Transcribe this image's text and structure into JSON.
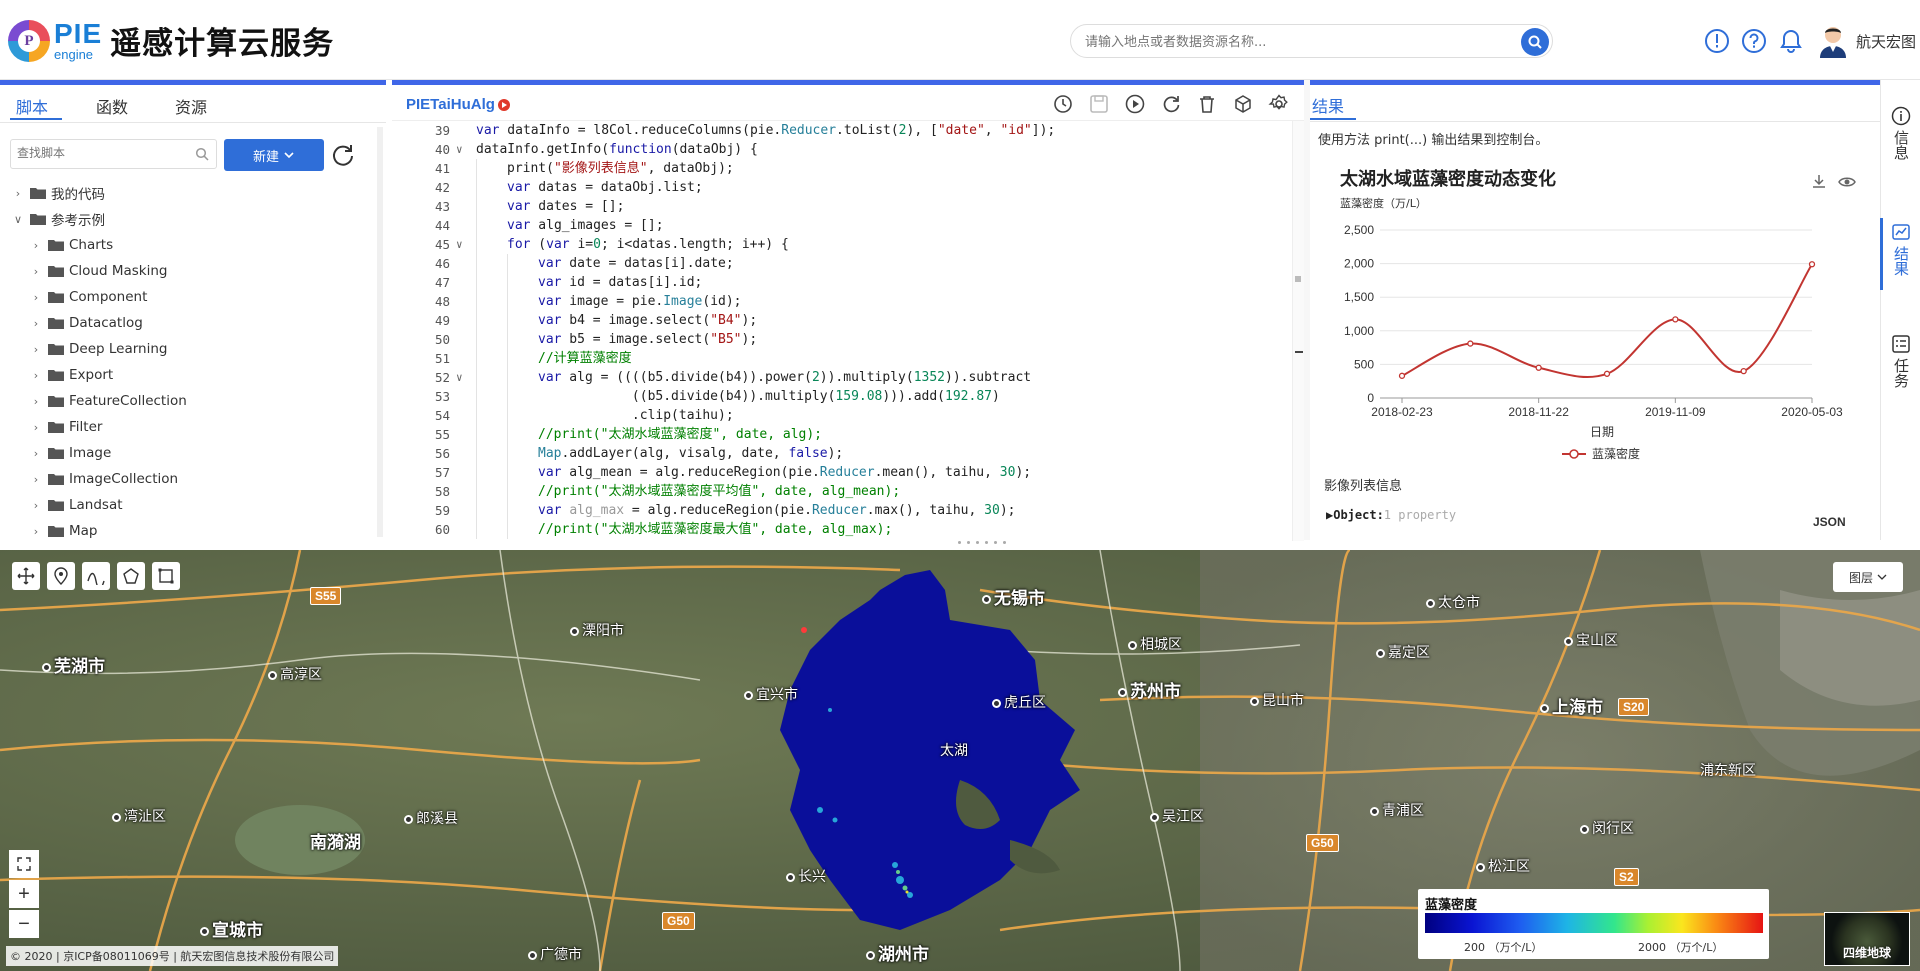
{
  "header": {
    "logo_text": "PIE",
    "logo_sub": "engine",
    "logo_p": "P",
    "title": "遥感计算云服务",
    "search_placeholder": "请输入地点或者数据资源名称...",
    "user_name": "航天宏图"
  },
  "left": {
    "tabs": [
      "脚本",
      "函数",
      "资源"
    ],
    "search_placeholder": "查找脚本",
    "new_button": "新建",
    "tree": [
      {
        "label": "我的代码",
        "level": 0,
        "open": false
      },
      {
        "label": "参考示例",
        "level": 0,
        "open": true
      },
      {
        "label": "Charts",
        "level": 1,
        "open": false
      },
      {
        "label": "Cloud Masking",
        "level": 1,
        "open": false
      },
      {
        "label": "Component",
        "level": 1,
        "open": false
      },
      {
        "label": "Datacatlog",
        "level": 1,
        "open": false
      },
      {
        "label": "Deep Learning",
        "level": 1,
        "open": false
      },
      {
        "label": "Export",
        "level": 1,
        "open": false
      },
      {
        "label": "FeatureCollection",
        "level": 1,
        "open": false
      },
      {
        "label": "Filter",
        "level": 1,
        "open": false
      },
      {
        "label": "Image",
        "level": 1,
        "open": false
      },
      {
        "label": "ImageCollection",
        "level": 1,
        "open": false
      },
      {
        "label": "Landsat",
        "level": 1,
        "open": false
      },
      {
        "label": "Map",
        "level": 1,
        "open": false
      }
    ]
  },
  "editor": {
    "file_name": "PIETaiHuAlg",
    "lines": [
      {
        "n": "39",
        "fold": "",
        "html": "<span class=\"kw\">var</span> dataInfo = l8Col.reduceColumns(pie.<span class=\"cls\">Reducer</span>.toList(<span class=\"num\">2</span>), [<span class=\"str\">\"date\"</span>, <span class=\"str\">\"id\"</span>]);",
        "indent": 0
      },
      {
        "n": "40",
        "fold": "v",
        "html": "dataInfo.getInfo(<span class=\"kw\">function</span>(dataObj) {",
        "indent": 0
      },
      {
        "n": "41",
        "fold": "",
        "html": "print(<span class=\"str\">\"影像列表信息\"</span>, dataObj);",
        "indent": 1
      },
      {
        "n": "42",
        "fold": "",
        "html": "<span class=\"kw\">var</span> datas = dataObj.list;",
        "indent": 1
      },
      {
        "n": "43",
        "fold": "",
        "html": "<span class=\"kw\">var</span> dates = [];",
        "indent": 1
      },
      {
        "n": "44",
        "fold": "",
        "html": "<span class=\"kw\">var</span> alg_images = [];",
        "indent": 1
      },
      {
        "n": "45",
        "fold": "v",
        "html": "<span class=\"kw\">for</span> (<span class=\"kw\">var</span> i=<span class=\"num\">0</span>; i&lt;datas.length; i++) {",
        "indent": 1
      },
      {
        "n": "46",
        "fold": "",
        "html": "<span class=\"kw\">var</span> date = datas[i].date;",
        "indent": 2
      },
      {
        "n": "47",
        "fold": "",
        "html": "<span class=\"kw\">var</span> id = datas[i].id;",
        "indent": 2
      },
      {
        "n": "48",
        "fold": "",
        "html": "<span class=\"kw\">var</span> image = pie.<span class=\"cls\">Image</span>(id);",
        "indent": 2
      },
      {
        "n": "49",
        "fold": "",
        "html": "<span class=\"kw\">var</span> b4 = image.select(<span class=\"str\">\"B4\"</span>);",
        "indent": 2
      },
      {
        "n": "50",
        "fold": "",
        "html": "<span class=\"kw\">var</span> b5 = image.select(<span class=\"str\">\"B5\"</span>);",
        "indent": 2
      },
      {
        "n": "51",
        "fold": "",
        "html": "<span class=\"cm\">//计算蓝藻密度</span>",
        "indent": 2
      },
      {
        "n": "52",
        "fold": "v",
        "html": "<span class=\"kw\">var</span> alg = ((((b5.divide(b4)).power(<span class=\"num\">2</span>)).multiply(<span class=\"num\">1352</span>)).subtract",
        "indent": 2
      },
      {
        "n": "53",
        "fold": "",
        "html": "            ((b5.divide(b4)).multiply(<span class=\"num\">159.08</span>))).add(<span class=\"num\">192.87</span>)",
        "indent": 2
      },
      {
        "n": "54",
        "fold": "",
        "html": "            .clip(taihu);",
        "indent": 2
      },
      {
        "n": "55",
        "fold": "",
        "html": "<span class=\"cm\">//print(\"太湖水域蓝藻密度\", date, alg);</span>",
        "indent": 2
      },
      {
        "n": "56",
        "fold": "",
        "html": "<span class=\"cls\">Map</span>.addLayer(alg, visalg, date, <span class=\"kw\">false</span>);",
        "indent": 2
      },
      {
        "n": "57",
        "fold": "",
        "html": "<span class=\"kw\">var</span> alg_mean = alg.reduceRegion(pie.<span class=\"cls\">Reducer</span>.mean(), taihu, <span class=\"num\">30</span>);",
        "indent": 2
      },
      {
        "n": "58",
        "fold": "",
        "html": "<span class=\"cm\">//print(\"太湖水域蓝藻密度平均值\", date, alg_mean);</span>",
        "indent": 2
      },
      {
        "n": "59",
        "fold": "",
        "html": "<span class=\"kw\">var</span> <span class=\"mut\">alg_max</span> = alg.reduceRegion(pie.<span class=\"cls\">Reducer</span>.max(), taihu, <span class=\"num\">30</span>);",
        "indent": 2
      },
      {
        "n": "60",
        "fold": "",
        "html": "<span class=\"cm\">//print(\"太湖水域蓝藻密度最大值\", date, alg_max);</span>",
        "indent": 2
      }
    ]
  },
  "results": {
    "tab": "结果",
    "hint": "使用方法 print(...) 输出结果到控制台。",
    "info_label": "影像列表信息",
    "object_key": "▶Object:",
    "object_note": "1 property",
    "json_label": "JSON"
  },
  "rail": {
    "info": "信息",
    "result": "结果",
    "task": "任务"
  },
  "chart_data": {
    "type": "line",
    "title": "太湖水域蓝藻密度动态变化",
    "ylabel": "蓝藻密度（万/L）",
    "xlabel": "日期",
    "legend": "蓝藻密度",
    "x_ticks": [
      "2018-02-23",
      "2018-11-22",
      "2019-11-09",
      "2020-05-03"
    ],
    "y_ticks": [
      "0",
      "500",
      "1,000",
      "1,500",
      "2,000",
      "2,500"
    ],
    "ylim": [
      0,
      2500
    ],
    "x": [
      "2018-02-23",
      "2018-07-10",
      "2018-11-22",
      "2019-04-15",
      "2019-11-09",
      "2020-01-20",
      "2020-05-03"
    ],
    "values": [
      330,
      810,
      450,
      360,
      1170,
      400,
      1990
    ],
    "color": "#c23531"
  },
  "map": {
    "layer_button": "图层",
    "legend_title": "蓝藻密度",
    "legend_min": "200 （万个/L）",
    "legend_max": "2000 （万个/L）",
    "globe_label": "四维地球",
    "copyright": "© 2020 | 京ICP备08011069号 | 航天宏图信息技术股份有限公司",
    "labels": [
      {
        "t": "无锡市",
        "big": true,
        "dot": true,
        "x": 982,
        "y": 34
      },
      {
        "t": "苏州市",
        "big": true,
        "dot": true,
        "x": 1118,
        "y": 127
      },
      {
        "t": "上海市",
        "big": true,
        "dot": true,
        "x": 1540,
        "y": 143
      },
      {
        "t": "湖州市",
        "big": true,
        "dot": true,
        "x": 866,
        "y": 390
      },
      {
        "t": "宣城市",
        "big": true,
        "dot": true,
        "x": 200,
        "y": 366
      },
      {
        "t": "芜湖市",
        "big": true,
        "dot": true,
        "x": 42,
        "y": 102
      },
      {
        "t": "南漪湖",
        "big": true,
        "dot": false,
        "x": 310,
        "y": 278
      },
      {
        "t": "溧阳市",
        "big": false,
        "dot": true,
        "x": 570,
        "y": 70
      },
      {
        "t": "宜兴市",
        "big": false,
        "dot": true,
        "x": 744,
        "y": 134
      },
      {
        "t": "长兴",
        "big": false,
        "dot": true,
        "x": 786,
        "y": 316
      },
      {
        "t": "虎丘区",
        "big": false,
        "dot": true,
        "x": 992,
        "y": 142
      },
      {
        "t": "相城区",
        "big": false,
        "dot": true,
        "x": 1128,
        "y": 84
      },
      {
        "t": "吴江区",
        "big": false,
        "dot": true,
        "x": 1150,
        "y": 256
      },
      {
        "t": "昆山市",
        "big": false,
        "dot": true,
        "x": 1250,
        "y": 140
      },
      {
        "t": "嘉定区",
        "big": false,
        "dot": true,
        "x": 1376,
        "y": 92
      },
      {
        "t": "宝山区",
        "big": false,
        "dot": true,
        "x": 1564,
        "y": 80
      },
      {
        "t": "太仓市",
        "big": false,
        "dot": true,
        "x": 1426,
        "y": 42
      },
      {
        "t": "青浦区",
        "big": false,
        "dot": true,
        "x": 1370,
        "y": 250
      },
      {
        "t": "松江区",
        "big": false,
        "dot": true,
        "x": 1476,
        "y": 306
      },
      {
        "t": "闵行区",
        "big": false,
        "dot": true,
        "x": 1580,
        "y": 268
      },
      {
        "t": "郎溪县",
        "big": false,
        "dot": true,
        "x": 404,
        "y": 258
      },
      {
        "t": "高淳区",
        "big": false,
        "dot": true,
        "x": 268,
        "y": 114
      },
      {
        "t": "湾沚区",
        "big": false,
        "dot": true,
        "x": 112,
        "y": 256
      },
      {
        "t": "广德市",
        "big": false,
        "dot": true,
        "x": 528,
        "y": 394
      },
      {
        "t": "浦东新区",
        "big": false,
        "dot": false,
        "x": 1700,
        "y": 210
      },
      {
        "t": "太湖",
        "big": false,
        "dot": false,
        "x": 940,
        "y": 190
      }
    ],
    "roads": [
      {
        "t": "S55",
        "x": 310,
        "y": 37
      },
      {
        "t": "G50",
        "x": 1306,
        "y": 284
      },
      {
        "t": "S20",
        "x": 1618,
        "y": 148
      },
      {
        "t": "G50",
        "x": 662,
        "y": 362
      },
      {
        "t": "S2",
        "x": 1614,
        "y": 318
      }
    ]
  }
}
